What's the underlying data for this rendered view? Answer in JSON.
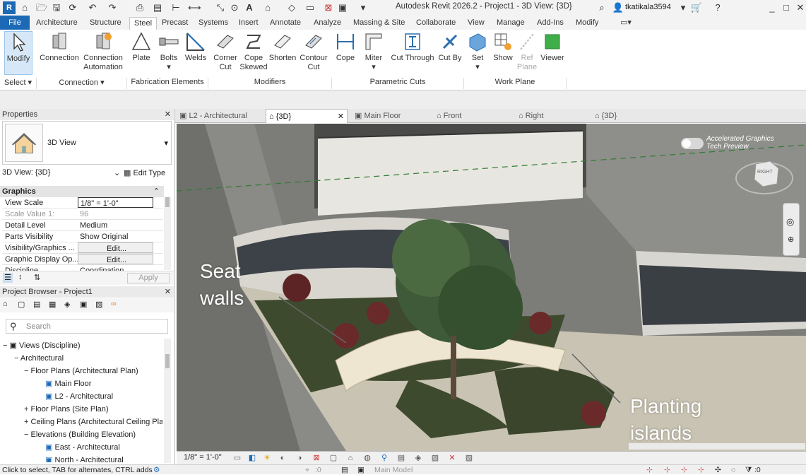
{
  "title": "Autodesk Revit 2026.2 - Project1 - 3D View: {3D}",
  "user": "tkatikala3594",
  "menu_tabs": [
    "File",
    "Architecture",
    "Structure",
    "Steel",
    "Precast",
    "Systems",
    "Insert",
    "Annotate",
    "Analyze",
    "Massing & Site",
    "Collaborate",
    "View",
    "Manage",
    "Add-Ins",
    "Modify"
  ],
  "active_tab": "Steel",
  "ribbon": {
    "buttons": [
      {
        "l1": "Modify",
        "l2": "",
        "icon": "cursor-arrow-icon"
      },
      {
        "l1": "Connection",
        "l2": "",
        "icon": "connection-icon"
      },
      {
        "l1": "Connection",
        "l2": "Automation",
        "icon": "connection-automation-icon"
      },
      {
        "l1": "Plate",
        "l2": "",
        "icon": "plate-icon"
      },
      {
        "l1": "Bolts",
        "l2": "▾",
        "icon": "bolts-icon"
      },
      {
        "l1": "Welds",
        "l2": "",
        "icon": "welds-icon"
      },
      {
        "l1": "Corner",
        "l2": "Cut",
        "icon": "corner-cut-icon"
      },
      {
        "l1": "Cope",
        "l2": "Skewed",
        "icon": "cope-skewed-icon"
      },
      {
        "l1": "Shorten",
        "l2": "",
        "icon": "shorten-icon"
      },
      {
        "l1": "Contour",
        "l2": "Cut",
        "icon": "contour-cut-icon"
      },
      {
        "l1": "Cope",
        "l2": "",
        "icon": "cope-icon"
      },
      {
        "l1": "Miter",
        "l2": "▾",
        "icon": "miter-icon"
      },
      {
        "l1": "Cut Through",
        "l2": "",
        "icon": "cut-through-icon"
      },
      {
        "l1": "Cut By",
        "l2": "",
        "icon": "cut-by-icon"
      },
      {
        "l1": "Set",
        "l2": "▾",
        "icon": "set-workplane-icon"
      },
      {
        "l1": "Show",
        "l2": "",
        "icon": "show-workplane-icon"
      },
      {
        "l1": "Ref",
        "l2": "Plane",
        "icon": "ref-plane-icon"
      },
      {
        "l1": "Viewer",
        "l2": "",
        "icon": "viewer-icon"
      }
    ],
    "panels": [
      "Select ▾",
      "Connection ▾",
      "Fabrication Elements",
      "Modifiers",
      "Parametric Cuts",
      "Work Plane"
    ]
  },
  "view_tabs": [
    "L2 - Architectural",
    "{3D}",
    "Main Floor",
    "Front",
    "Right",
    "{3D}"
  ],
  "properties": {
    "header": "Properties",
    "type_name": "3D View",
    "selector": "3D View: {3D}",
    "edit_type": "Edit Type",
    "group": "Graphics",
    "rows": [
      {
        "k": "View Scale",
        "v": "1/8\" = 1'-0\""
      },
      {
        "k": "Scale Value    1:",
        "v": "96"
      },
      {
        "k": "Detail Level",
        "v": "Medium"
      },
      {
        "k": "Parts Visibility",
        "v": "Show Original"
      },
      {
        "k": "Visibility/Graphics ...",
        "v": "Edit..."
      },
      {
        "k": "Graphic Display Op...",
        "v": "Edit..."
      },
      {
        "k": "Discipline",
        "v": "Coordination"
      }
    ],
    "apply": "Apply"
  },
  "browser": {
    "header": "Project Browser - Project1",
    "search_placeholder": "Search",
    "items": [
      {
        "t": "Views (Discipline)",
        "exp": "−"
      },
      {
        "t": "Architectural",
        "exp": "−"
      },
      {
        "t": "Floor Plans (Architectural Plan)",
        "exp": "−"
      },
      {
        "t": "Main Floor",
        "exp": ""
      },
      {
        "t": "L2 - Architectural",
        "exp": ""
      },
      {
        "t": "Floor Plans (Site Plan)",
        "exp": "+"
      },
      {
        "t": "Ceiling Plans (Architectural Ceiling Pla",
        "exp": "+"
      },
      {
        "t": "Elevations (Building Elevation)",
        "exp": "−"
      },
      {
        "t": "East - Architectural",
        "exp": ""
      },
      {
        "t": "North - Architectural",
        "exp": ""
      }
    ]
  },
  "viewport": {
    "accel_label_1": "Accelerated Graphics",
    "accel_label_2": "Tech Preview",
    "cube_face": "RIGHT",
    "annotation_1a": "Seat",
    "annotation_1b": "walls",
    "annotation_2a": "Planting",
    "annotation_2b": "islands"
  },
  "view_scale": "1/8\" = 1'-0\"",
  "status_text": "Click to select, TAB for alternates, CTRL adds",
  "status_coord": ":0",
  "workset": "Main Model",
  "filter_count": ":0"
}
